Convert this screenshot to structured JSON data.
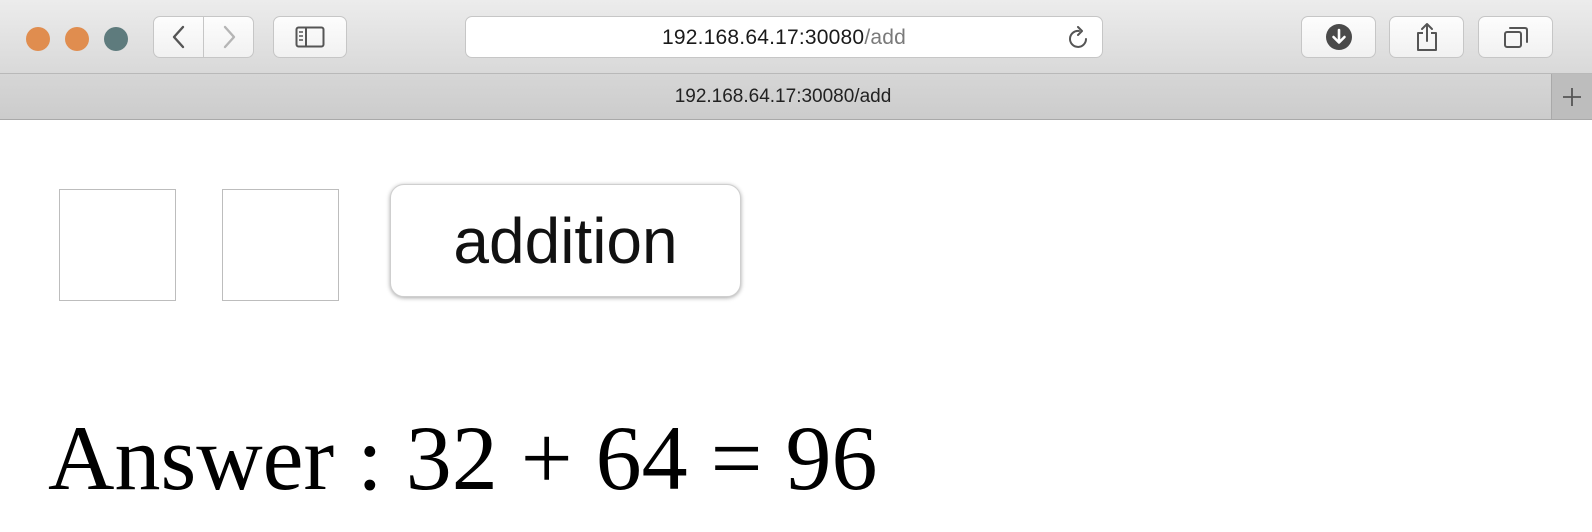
{
  "browser": {
    "address_host": "192.168.64.17:30080",
    "address_path": "/add",
    "tab_title": "192.168.64.17:30080/add",
    "traffic_light_colors": [
      "#e08d4f",
      "#e08d4f",
      "#5e7b7d"
    ],
    "icons": [
      "chevron-left-icon",
      "chevron-right-icon",
      "sidebar-icon",
      "reload-icon",
      "download-icon",
      "share-icon",
      "tabs-overview-icon",
      "plus-icon"
    ]
  },
  "form": {
    "first_number": "",
    "second_number": "",
    "button_label": "addition"
  },
  "result": {
    "text": "Answer : 32 + 64 = 96"
  }
}
